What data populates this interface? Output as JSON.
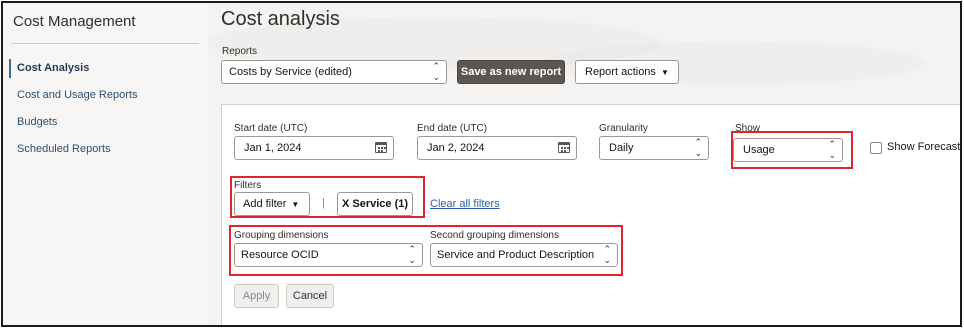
{
  "sidebar": {
    "title": "Cost Management",
    "items": [
      {
        "label": "Cost Analysis"
      },
      {
        "label": "Cost and Usage Reports"
      },
      {
        "label": "Budgets"
      },
      {
        "label": "Scheduled Reports"
      }
    ]
  },
  "main": {
    "title": "Cost analysis",
    "reports_label": "Reports",
    "report_value": "Costs by Service (edited)",
    "save_button": "Save as new report",
    "actions_button": "Report actions"
  },
  "filters_panel": {
    "start_date": {
      "label": "Start date (UTC)",
      "value": "Jan 1, 2024"
    },
    "end_date": {
      "label": "End date (UTC)",
      "value": "Jan 2, 2024"
    },
    "granularity": {
      "label": "Granularity",
      "value": "Daily"
    },
    "show": {
      "label": "Show",
      "value": "Usage"
    },
    "show_forecast": {
      "label": "Show Forecast",
      "checked": false
    },
    "filters_label": "Filters",
    "add_filter": "Add filter",
    "separator": "|",
    "service_chip": "X Service (1)",
    "clear_all": "Clear all filters",
    "grouping": {
      "label": "Grouping dimensions",
      "value": "Resource OCID"
    },
    "second_grouping": {
      "label": "Second grouping dimensions",
      "value": "Service and Product Description"
    },
    "apply": "Apply",
    "cancel": "Cancel"
  },
  "colors": {
    "highlight": "#e0262a",
    "primary_button": "#5b5652",
    "link": "#2e5f9e"
  },
  "icons": [
    "calendar-icon",
    "chevron-updown-icon",
    "caret-down-icon"
  ]
}
